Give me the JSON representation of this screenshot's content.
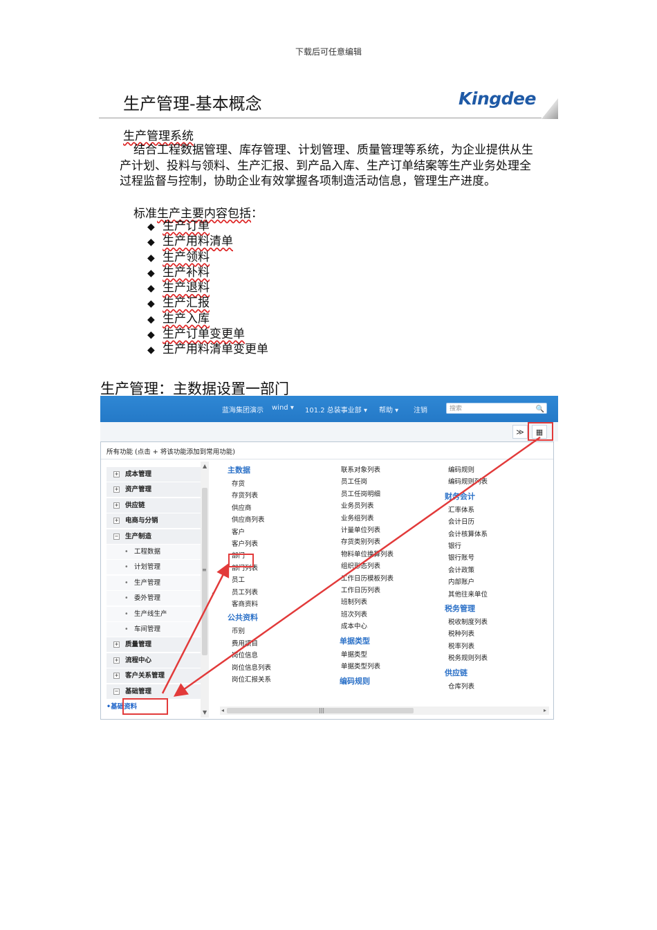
{
  "header_note": "下载后可任意编辑",
  "slide": {
    "title": "生产管理-基本概念",
    "logo": "Kingdee",
    "heading": "生产管理系统",
    "paragraph": "结合工程数据管理、库存管理、计划管理、质量管理等系统，为企业提供从生产计划、投料与领料、生产汇报、到产品入库、生产订单结案等生产业务处理全过程监督与控制，协助企业有效掌握各项制造活动信息，管理生产进度。",
    "intro_prefix": "标准",
    "intro_wavy": "生产主要内容包括",
    "intro_suffix": "：",
    "bullet_glyph": "◆",
    "bullets": [
      "生产订单",
      "生产用料清单",
      "生产领料",
      "生产补料",
      "生产退料",
      "生产汇报",
      "生产入库",
      "生产订单变更单",
      "生产用料清单变更单"
    ]
  },
  "section_title": "生产管理：主数据设置一部门",
  "app": {
    "topbar": {
      "org": "蓝海集团演示",
      "user": "wind ▾",
      "dept": "101.2 总装事业部 ▾",
      "help": "帮助 ▾",
      "logout": "注销",
      "search_placeholder": "搜索",
      "search_icon": "🔍"
    },
    "controls": {
      "collapse_glyph": "≫",
      "grid_glyph": "▦"
    },
    "panel_header": "所有功能   (点击 + 将该功能添加到常用功能)",
    "tree": [
      {
        "label": "成本管理",
        "kind": "grp",
        "box": "+"
      },
      {
        "label": "资产管理",
        "kind": "grp",
        "box": "+"
      },
      {
        "label": "供应链",
        "kind": "grp",
        "box": "+"
      },
      {
        "label": "电商与分销",
        "kind": "grp",
        "box": "+"
      },
      {
        "label": "生产制造",
        "kind": "grp",
        "box": "−"
      },
      {
        "label": "工程数据",
        "kind": "sub"
      },
      {
        "label": "计划管理",
        "kind": "sub"
      },
      {
        "label": "生产管理",
        "kind": "sub"
      },
      {
        "label": "委外管理",
        "kind": "sub"
      },
      {
        "label": "生产线生产",
        "kind": "sub"
      },
      {
        "label": "车间管理",
        "kind": "sub"
      },
      {
        "label": "质量管理",
        "kind": "grp",
        "box": "+"
      },
      {
        "label": "流程中心",
        "kind": "grp",
        "box": "+"
      },
      {
        "label": "客户关系管理",
        "kind": "grp",
        "box": "+"
      },
      {
        "label": "基础管理",
        "kind": "grp",
        "box": "−"
      },
      {
        "label": "基础资料",
        "kind": "active"
      }
    ],
    "col1": {
      "section1": "主数据",
      "items1": [
        "存货",
        "存货列表",
        "供应商",
        "供应商列表",
        "客户",
        "客户列表",
        "部门",
        "部门列表",
        "员工",
        "员工列表",
        "客商资料"
      ],
      "section2": "公共资料",
      "items2": [
        "币别",
        "费用项目",
        "岗位信息",
        "岗位信息列表",
        "岗位汇报关系"
      ]
    },
    "col2": {
      "items1": [
        "联系对象列表",
        "员工任岗",
        "员工任岗明细",
        "业务员列表",
        "业务组列表",
        "计量单位列表",
        "存货类别列表",
        "物料单位换算列表",
        "组织形态列表",
        "工作日历模板列表",
        "工作日历列表",
        "班制列表",
        "班次列表",
        "成本中心"
      ],
      "section2": "单据类型",
      "items2": [
        "单据类型",
        "单据类型列表"
      ],
      "section3": "编码规则"
    },
    "col3": {
      "items0": [
        "编码规则",
        "编码规则列表"
      ],
      "section1": "财务会计",
      "items1": [
        "汇率体系",
        "会计日历",
        "会计核算体系",
        "银行",
        "银行账号",
        "会计政策",
        "内部账户",
        "其他往来单位"
      ],
      "section2": "税务管理",
      "items2": [
        "税收制度列表",
        "税种列表",
        "税率列表",
        "税务规则列表"
      ],
      "section3": "供应链",
      "items3": [
        "仓库列表"
      ]
    },
    "scroll_glyphs": {
      "up": "▲",
      "down": "▼",
      "left": "◂",
      "right": "▸",
      "grip": "|||",
      "side_grip": "≡",
      "collapse": "‹"
    }
  }
}
